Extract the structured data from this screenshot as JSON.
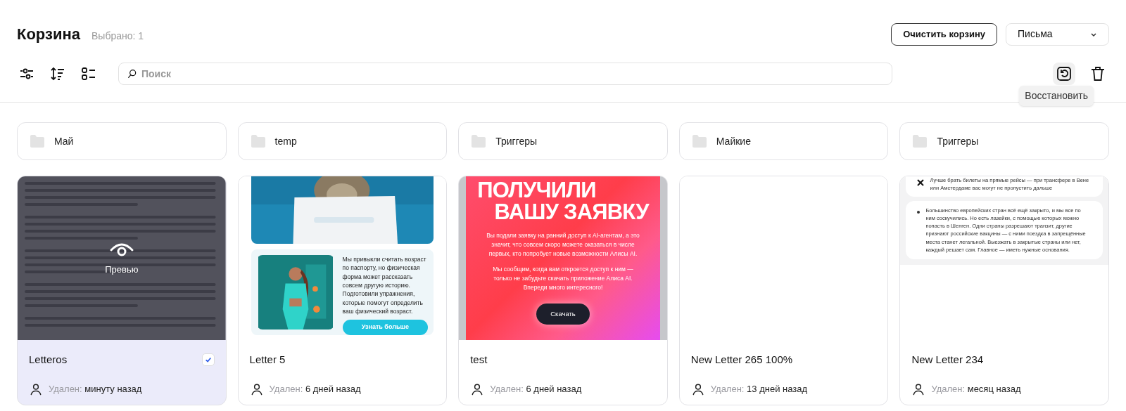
{
  "header": {
    "title": "Корзина",
    "selected_count": "Выбрано: 1",
    "clear_button": "Очистить корзину",
    "type_select": "Письма"
  },
  "toolbar": {
    "search_placeholder": "Поиск",
    "tooltip": "Восстановить"
  },
  "folders": [
    "Май",
    "temp",
    "Триггеры",
    "Майкие",
    "Триггеры"
  ],
  "letters": [
    {
      "name": "Letteros",
      "selected": true,
      "deleted_label": "Удален:",
      "deleted_time": "минуту назад",
      "preview": {
        "kind": "document",
        "overlay": "Превью"
      }
    },
    {
      "name": "Letter 5",
      "selected": false,
      "deleted_label": "Удален:",
      "deleted_time": "6 дней назад",
      "preview": {
        "kind": "digest",
        "text": "Мы привыкли считать возраст по паспорту, но физическая форма может рассказать совсем другую историю. Подготовили упражнения, которые помогут определить ваш физический возраст.",
        "button": "Узнать больше"
      }
    },
    {
      "name": "test",
      "selected": false,
      "deleted_label": "Удален:",
      "deleted_time": "6 дней назад",
      "preview": {
        "kind": "promo",
        "headline": [
          "ПОЛУЧИЛИ",
          "ВАШУ ЗАЯВКУ"
        ],
        "paragraphs": [
          "Вы подали заявку на ранний доступ к AI-агентам, а это значит, что совсем скоро можете оказаться в числе первых, кто попробует новые возможности Алисы AI.",
          "Мы сообщим, когда вам откроется доступ к ним — только не забудьте скачать приложение Алиса AI. Впереди много интересного!"
        ],
        "button": "Скачать"
      }
    },
    {
      "name": "New Letter 265 100%",
      "selected": false,
      "deleted_label": "Удален:",
      "deleted_time": "13 дней назад",
      "preview": {
        "kind": "blank"
      }
    },
    {
      "name": "New Letter 234",
      "selected": false,
      "deleted_label": "Удален:",
      "deleted_time": "месяц назад",
      "preview": {
        "kind": "article",
        "note": "Лучше брать билеты на прямые рейсы — при трансфере в Вене или Амстердаме вас могут не пропустить дальше",
        "bullet": "Большинство европейских стран всё ещё закрыто, и мы все по ним соскучились. Но есть лазейки, с помощью которых можно попасть в Шенген. Одни страны разрешают транзит, другие признают российские вакцины — с ними поездка в запрещённые места станет легальной. Выезжать в закрытые страны или нет, каждый решает сам. Главное — иметь нужные основания."
      }
    }
  ]
}
